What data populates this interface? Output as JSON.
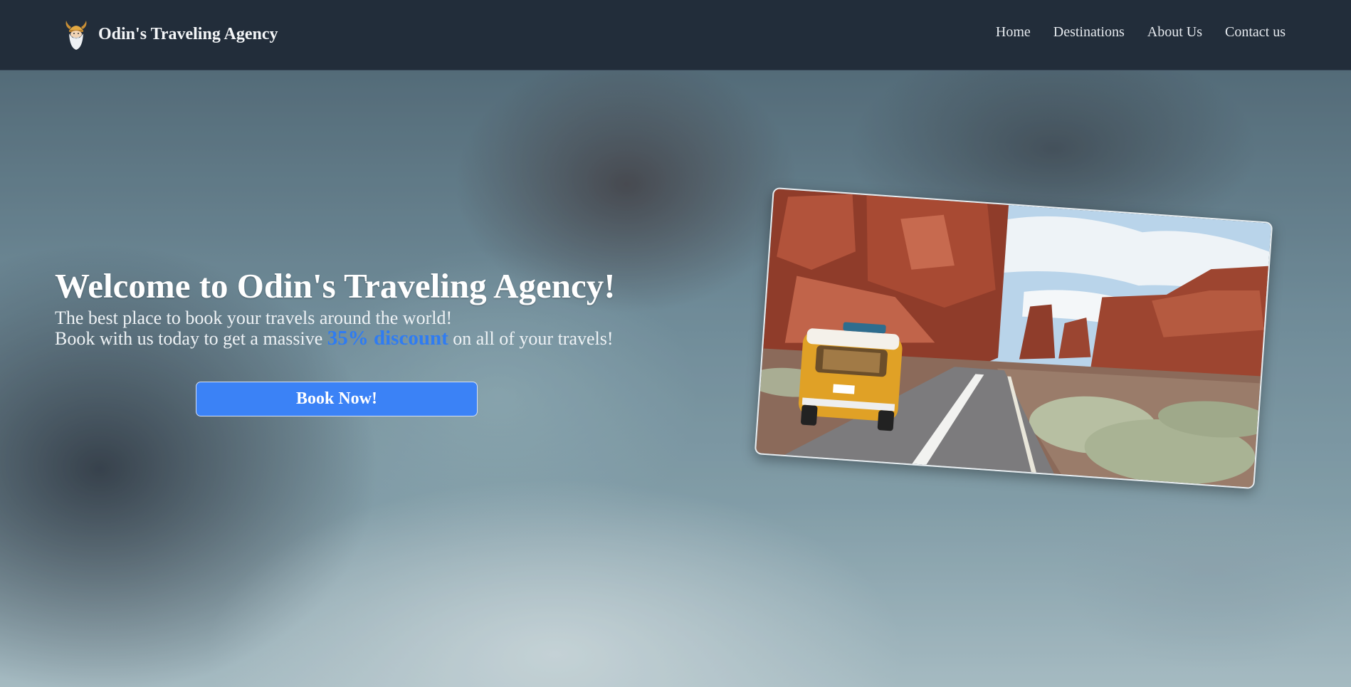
{
  "header": {
    "brand_name": "Odin's Traveling Agency",
    "logo_icon": "viking-head-icon",
    "nav": [
      {
        "label": "Home"
      },
      {
        "label": "Destinations"
      },
      {
        "label": "About Us"
      },
      {
        "label": "Contact us"
      }
    ]
  },
  "hero": {
    "title": "Welcome to Odin's Traveling Agency!",
    "subtitle": "The best place to book your travels around the world!",
    "offer_prefix": "Book with us today to get a massive",
    "offer_highlight": "35% discount",
    "offer_suffix": "on all of your travels!",
    "cta_label": "Book Now!",
    "image_icon": "desert-road-van-photo"
  },
  "colors": {
    "navbar": "#222d3a",
    "accent": "#3b82f6",
    "highlight": "#2f7cf2",
    "text": "#f4f6f8"
  }
}
